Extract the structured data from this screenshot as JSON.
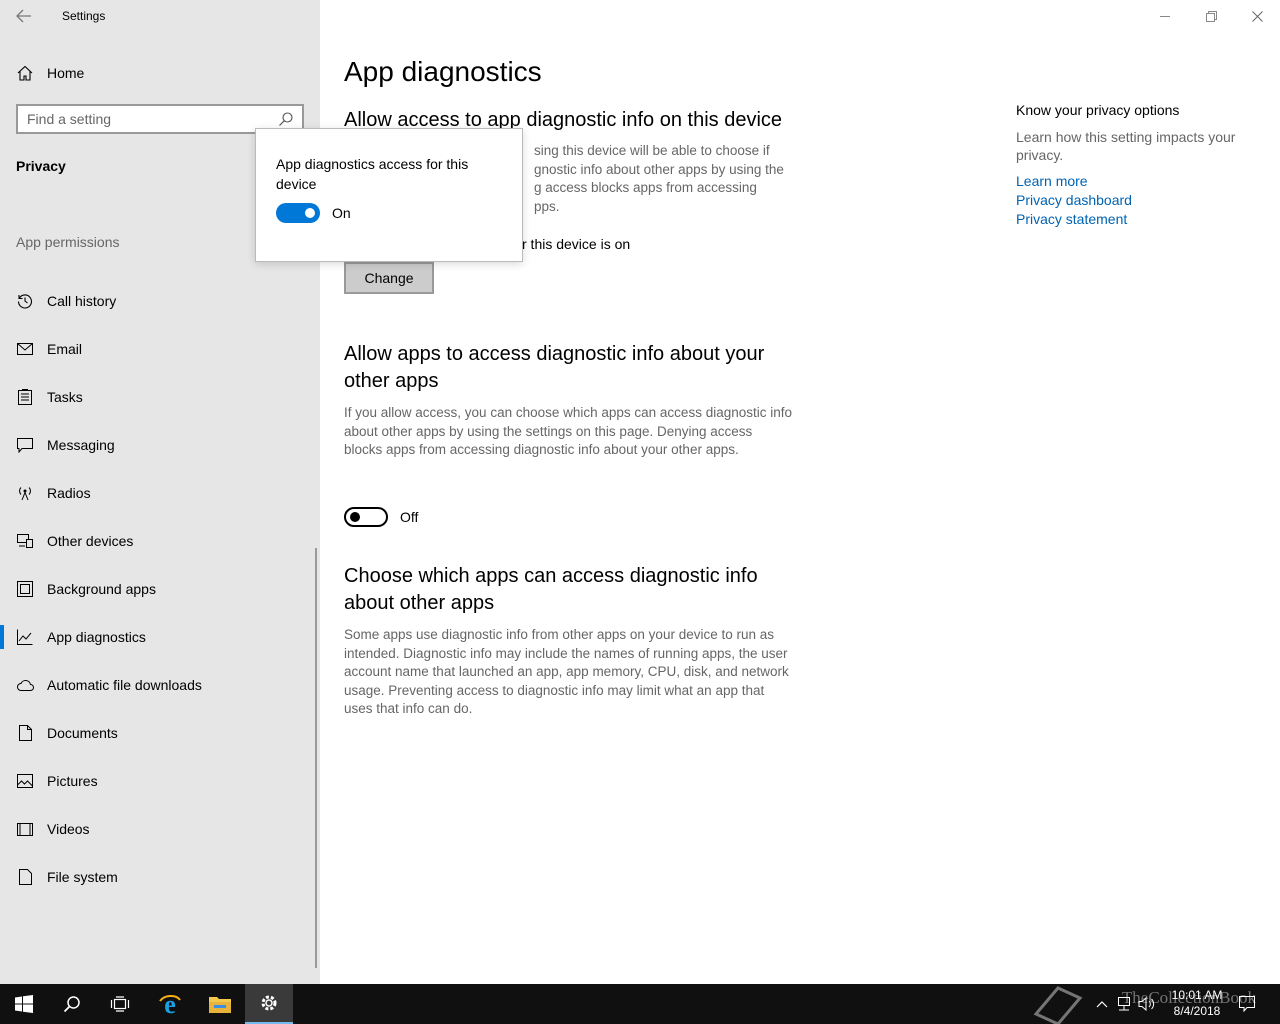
{
  "window": {
    "title": "Settings",
    "back_icon": "back-arrow-icon",
    "minimize_icon": "minimize-icon",
    "restore_icon": "restore-icon",
    "close_icon": "close-icon"
  },
  "sidebar": {
    "home_label": "Home",
    "search_placeholder": "Find a setting",
    "section": "Privacy",
    "group_label": "App permissions",
    "items": [
      {
        "label": "Call history",
        "icon": "history-icon"
      },
      {
        "label": "Email",
        "icon": "mail-icon"
      },
      {
        "label": "Tasks",
        "icon": "tasks-icon"
      },
      {
        "label": "Messaging",
        "icon": "message-icon"
      },
      {
        "label": "Radios",
        "icon": "antenna-icon"
      },
      {
        "label": "Other devices",
        "icon": "devices-icon"
      },
      {
        "label": "Background apps",
        "icon": "background-apps-icon"
      },
      {
        "label": "App diagnostics",
        "icon": "diagnostics-icon",
        "selected": true
      },
      {
        "label": "Automatic file downloads",
        "icon": "cloud-icon"
      },
      {
        "label": "Documents",
        "icon": "document-icon"
      },
      {
        "label": "Pictures",
        "icon": "picture-icon"
      },
      {
        "label": "Videos",
        "icon": "video-icon"
      },
      {
        "label": "File system",
        "icon": "file-icon"
      }
    ]
  },
  "main": {
    "title": "App diagnostics",
    "section1": {
      "heading": "Allow access to app diagnostic info on this device",
      "para_lines": [
        "sing this device will be able to choose if",
        "gnostic info about other apps by using the",
        "g access blocks apps from accessing",
        "pps."
      ],
      "status": "r this device is on",
      "change_label": "Change"
    },
    "section2": {
      "heading": "Allow apps to access diagnostic info about your other apps",
      "para": "If you allow access, you can choose which apps can access diagnostic info about other apps by using the settings on this page. Denying access blocks apps from accessing diagnostic info about your other apps.",
      "toggle_state": "Off"
    },
    "section3": {
      "heading": "Choose which apps can access diagnostic info about other apps",
      "para": "Some apps use diagnostic info from other apps on your device to run as intended. Diagnostic info may include the names of running apps, the user account name that launched an app, app memory, CPU, disk, and network usage. Preventing access to diagnostic info may limit what an app that uses that info can do."
    }
  },
  "right_col": {
    "title": "Know your privacy options",
    "text": "Learn how this setting impacts your privacy.",
    "links": [
      "Learn more",
      "Privacy dashboard",
      "Privacy statement"
    ]
  },
  "popup": {
    "title": "App diagnostics access for this device",
    "toggle_state": "On"
  },
  "taskbar": {
    "time": "10:01 AM",
    "date": "8/4/2018",
    "watermark": "TheCollectionBook",
    "pinned": [
      "start-icon",
      "search-icon",
      "task-view-icon",
      "edge-icon",
      "file-explorer-icon",
      "settings-gear-icon"
    ]
  },
  "colors": {
    "accent": "#0078d7",
    "link": "#0063b1",
    "sidebar_bg": "#e6e6e6",
    "taskbar_bg": "#101010"
  }
}
